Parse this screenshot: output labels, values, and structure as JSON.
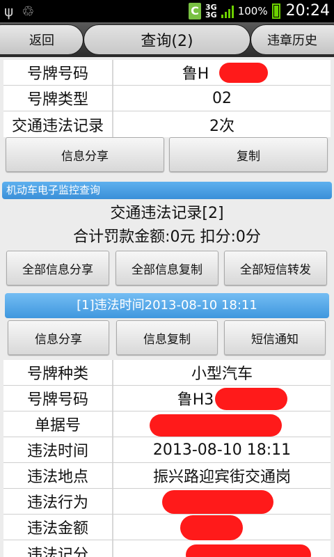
{
  "status_bar": {
    "net": "3G",
    "net2": "3G",
    "battery": "100%",
    "time": "20:24"
  },
  "header": {
    "back_label": "返回",
    "title": "查询(2)",
    "history_label": "违章历史"
  },
  "vehicle": {
    "rows": [
      {
        "key": "号牌号码",
        "value": "鲁H"
      },
      {
        "key": "号牌类型",
        "value": "02"
      },
      {
        "key": "交通违法记录",
        "value": "2次"
      }
    ]
  },
  "vehicle_actions": {
    "share": "信息分享",
    "copy": "复制"
  },
  "section": {
    "title": "机动车电子监控查询"
  },
  "summary": {
    "records": "交通违法记录[2]",
    "totals": "合计罚款金额:0元 扣分:0分"
  },
  "summary_actions": {
    "share_all": "全部信息分享",
    "copy_all": "全部信息复制",
    "sms_all": "全部短信转发"
  },
  "record": {
    "title": "[1]违法时间2013-08-10 18:11",
    "actions": {
      "share": "信息分享",
      "copy": "信息复制",
      "sms": "短信通知"
    },
    "rows": [
      {
        "key": "号牌种类",
        "value": "小型汽车"
      },
      {
        "key": "号牌号码",
        "value": "鲁H3"
      },
      {
        "key": "单据号",
        "value": ""
      },
      {
        "key": "违法时间",
        "value": "2013-08-10 18:11"
      },
      {
        "key": "违法地点",
        "value": "振兴路迎宾街交通岗"
      },
      {
        "key": "违法行为",
        "value": ""
      },
      {
        "key": "违法金额",
        "value": ""
      },
      {
        "key": "违法记分",
        "value": ""
      }
    ]
  },
  "colors": {
    "accent_blue": "#3a8fd8",
    "redaction": "#ff1a1a",
    "battery_green": "#6cd000"
  }
}
